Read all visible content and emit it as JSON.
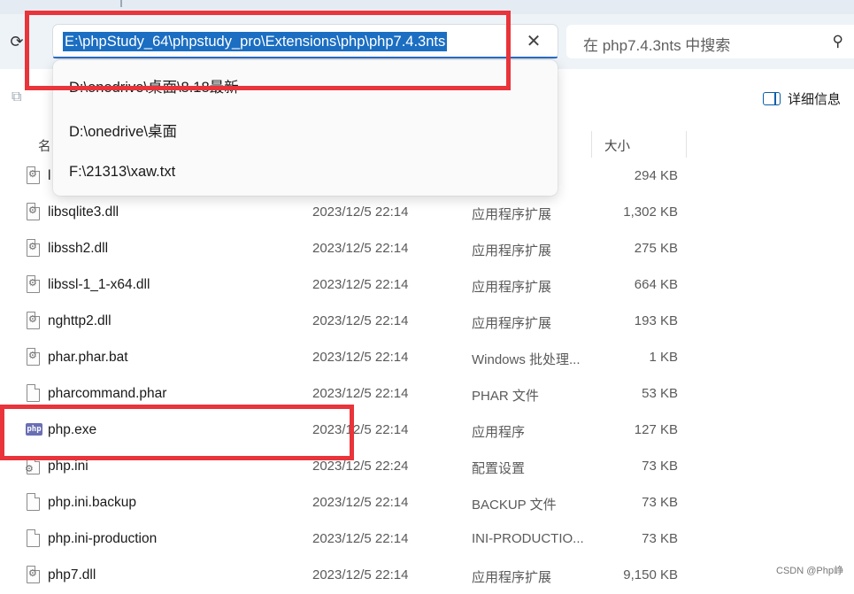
{
  "address_bar": {
    "path": "E:\\phpStudy_64\\phpstudy_pro\\Extensions\\php\\php7.4.3nts",
    "clear_glyph": "✕",
    "refresh_glyph": "⟳"
  },
  "search": {
    "placeholder": "在 php7.4.3nts 中搜索",
    "icon_glyph": "⚲"
  },
  "toolbar": {
    "details_label": "详细信息",
    "copy_glyph": "⧉"
  },
  "columns": {
    "name": "名",
    "size": "大小"
  },
  "dropdown": {
    "items": [
      {
        "label": "D:\\onedrive\\桌面\\8.18最新"
      },
      {
        "label": "D:\\onedrive\\桌面"
      },
      {
        "label": "F:\\21313\\xaw.txt"
      }
    ]
  },
  "files": [
    {
      "name": "l",
      "date": "",
      "type": "",
      "size": "294 KB",
      "icon": "dll"
    },
    {
      "name": "libsqlite3.dll",
      "date": "2023/12/5 22:14",
      "type": "应用程序扩展",
      "size": "1,302 KB",
      "icon": "dll"
    },
    {
      "name": "libssh2.dll",
      "date": "2023/12/5 22:14",
      "type": "应用程序扩展",
      "size": "275 KB",
      "icon": "dll"
    },
    {
      "name": "libssl-1_1-x64.dll",
      "date": "2023/12/5 22:14",
      "type": "应用程序扩展",
      "size": "664 KB",
      "icon": "dll"
    },
    {
      "name": "nghttp2.dll",
      "date": "2023/12/5 22:14",
      "type": "应用程序扩展",
      "size": "193 KB",
      "icon": "dll"
    },
    {
      "name": "phar.phar.bat",
      "date": "2023/12/5 22:14",
      "type": "Windows 批处理...",
      "size": "1 KB",
      "icon": "bat"
    },
    {
      "name": "pharcommand.phar",
      "date": "2023/12/5 22:14",
      "type": "PHAR 文件",
      "size": "53 KB",
      "icon": "file"
    },
    {
      "name": "php.exe",
      "date": "2023/12/5 22:14",
      "type": "应用程序",
      "size": "127 KB",
      "icon": "php",
      "icon_label": "php"
    },
    {
      "name": "php.ini",
      "date": "2023/12/5 22:24",
      "type": "配置设置",
      "size": "73 KB",
      "icon": "ini"
    },
    {
      "name": "php.ini.backup",
      "date": "2023/12/5 22:14",
      "type": "BACKUP 文件",
      "size": "73 KB",
      "icon": "file"
    },
    {
      "name": "php.ini-production",
      "date": "2023/12/5 22:14",
      "type": "INI-PRODUCTIO...",
      "size": "73 KB",
      "icon": "file"
    },
    {
      "name": "php7.dll",
      "date": "2023/12/5 22:14",
      "type": "应用程序扩展",
      "size": "9,150 KB",
      "icon": "dll"
    }
  ],
  "watermark": "CSDN @Php峥",
  "colors": {
    "highlight_red": "#e8343a",
    "selection_blue": "#1b6ec2",
    "php_icon": "#6a6fb4"
  }
}
